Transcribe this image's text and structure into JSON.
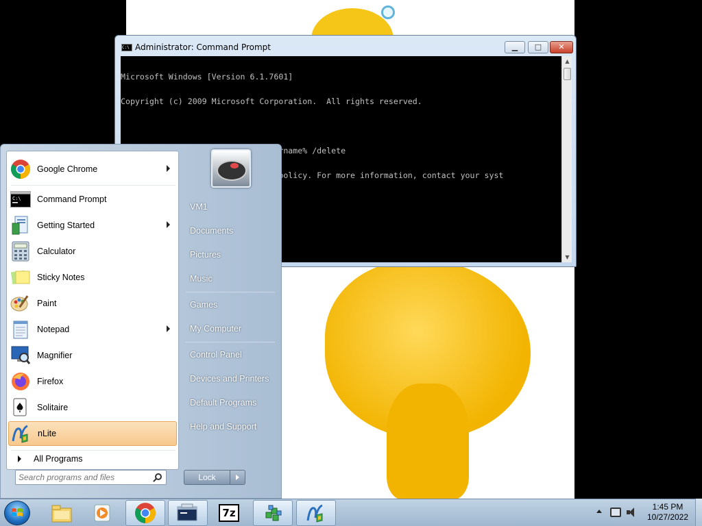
{
  "cmd_window": {
    "title": "Administrator: Command Prompt",
    "icon_text": "C:\\",
    "lines": [
      "Microsoft Windows [Version 6.1.7601]",
      "Copyright (c) 2009 Microsoft Corporation.  All rights reserved.",
      "",
      "C:\\Windows\\system32>net user %username% /delete",
      "This program is blocked by group policy. For more information, contact your syst",
      "em administrator.",
      "",
      "C:\\Windows\\system32>"
    ],
    "controls": {
      "minimize": "▁",
      "maximize": "□",
      "close": "✕"
    }
  },
  "start_menu": {
    "programs": [
      {
        "label": "Google Chrome",
        "icon": "chrome-icon",
        "has_submenu": true
      },
      {
        "label": "Command Prompt",
        "icon": "cmd-icon",
        "has_submenu": false
      },
      {
        "label": "Getting Started",
        "icon": "getting-started-icon",
        "has_submenu": true
      },
      {
        "label": "Calculator",
        "icon": "calculator-icon",
        "has_submenu": false
      },
      {
        "label": "Sticky Notes",
        "icon": "sticky-notes-icon",
        "has_submenu": false
      },
      {
        "label": "Paint",
        "icon": "paint-icon",
        "has_submenu": false
      },
      {
        "label": "Notepad",
        "icon": "notepad-icon",
        "has_submenu": true
      },
      {
        "label": "Magnifier",
        "icon": "magnifier-icon",
        "has_submenu": false
      },
      {
        "label": "Firefox",
        "icon": "firefox-icon",
        "has_submenu": false
      },
      {
        "label": "Solitaire",
        "icon": "solitaire-icon",
        "has_submenu": false
      },
      {
        "label": "nLite",
        "icon": "nlite-icon",
        "has_submenu": false,
        "highlighted": true
      }
    ],
    "all_programs": "All Programs",
    "search_placeholder": "Search programs and files",
    "right_items": [
      "VM1",
      "Documents",
      "Pictures",
      "Music",
      "Games",
      "My Computer",
      "Control Panel",
      "Devices and Printers",
      "Default Programs",
      "Help and Support"
    ],
    "lock_label": "Lock"
  },
  "taskbar": {
    "buttons": [
      {
        "icon": "explorer-icon",
        "active": false
      },
      {
        "icon": "media-player-icon",
        "active": false
      },
      {
        "icon": "chrome-icon",
        "active": true
      },
      {
        "icon": "cmd-icon",
        "active": true
      },
      {
        "icon": "7zip-icon",
        "active": false,
        "text": "7z"
      },
      {
        "icon": "tool-icon",
        "active": false
      },
      {
        "icon": "nlite-icon",
        "active": true
      }
    ],
    "clock_time": "1:45 PM",
    "clock_date": "10/27/2022"
  }
}
